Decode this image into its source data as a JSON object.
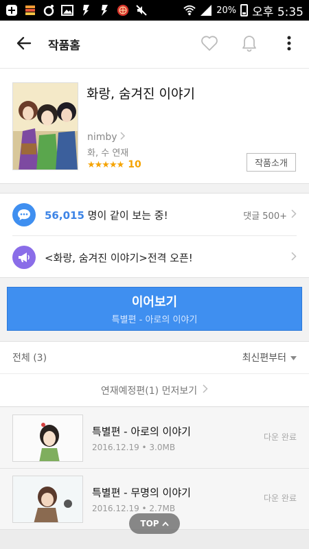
{
  "status_bar": {
    "icons": [
      "plus-square-icon",
      "stack-icon",
      "circle-ring-icon",
      "image-icon",
      "bolt-icon",
      "bolt-icon",
      "app-badge-icon",
      "mute-icon",
      "wifi-icon",
      "signal-icon"
    ],
    "battery": "20%",
    "time": "오후 5:35"
  },
  "app_bar": {
    "title": "작품홈",
    "icons": [
      "back-arrow-icon",
      "heart-icon",
      "bell-icon",
      "more-vert-icon"
    ]
  },
  "work": {
    "title": "화랑, 숨겨진 이야기",
    "author": "nimby",
    "schedule": "화, 수 연재",
    "stars": "★★★★★",
    "score": "10",
    "intro_button": "작품소개"
  },
  "notices": {
    "watching_count": "56,015",
    "watching_text": " 명이 같이 보는 중!",
    "comments": "댓글 500+",
    "announcement": "<화랑, 숨겨진 이야기>전격 오픈!"
  },
  "continue": {
    "label": "이어보기",
    "subtitle": "특별편 - 아로의 이야기"
  },
  "list": {
    "total": "전체 (3)",
    "sort": "최신편부터",
    "preview": "연재예정편(1) 먼저보기"
  },
  "episodes": [
    {
      "title": "특별편 - 아로의 이야기",
      "meta": "2016.12.19 • 3.0MB",
      "status": "다운 완료"
    },
    {
      "title": "특별편 - 무명의 이야기",
      "meta": "2016.12.19 • 2.7MB",
      "status": "다운 완료"
    }
  ],
  "top_button": "TOP",
  "colors": {
    "accent_blue": "#3f8ff0",
    "purple": "#8a6de8",
    "star": "#f5a300",
    "count_blue": "#3d84e6"
  }
}
